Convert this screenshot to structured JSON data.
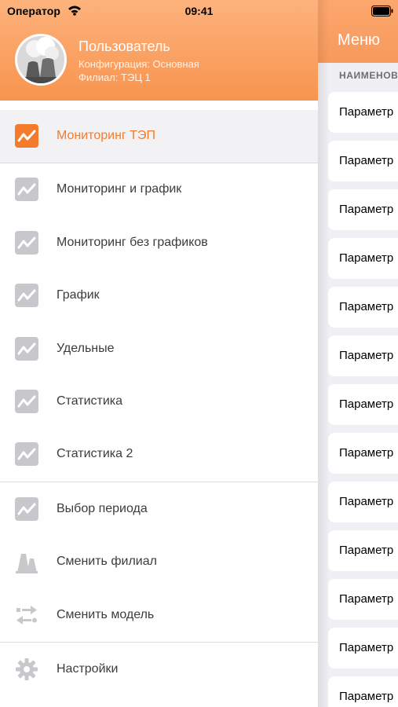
{
  "status_bar": {
    "carrier": "Оператор",
    "time": "09:41"
  },
  "background_screen": {
    "nav_title": "Меню",
    "section_header": "НАИМЕНОВ",
    "rows": [
      "Параметр",
      "Параметр",
      "Параметр",
      "Параметр",
      "Параметр",
      "Параметр",
      "Параметр",
      "Параметр",
      "Параметр",
      "Параметр",
      "Параметр",
      "Параметр",
      "Параметр"
    ]
  },
  "drawer": {
    "user": {
      "name": "Пользователь",
      "configuration": "Конфигурация: Основная",
      "branch": "Филиал: ТЭЦ 1"
    },
    "menu_items": [
      {
        "label": "Мониторинг ТЭП",
        "icon": "chart-icon",
        "selected": true
      },
      {
        "label": "Мониторинг и график",
        "icon": "chart-icon"
      },
      {
        "label": "Мониторинг без графиков",
        "icon": "chart-icon"
      },
      {
        "label": "График",
        "icon": "chart-icon"
      },
      {
        "label": "Удельные",
        "icon": "chart-icon"
      },
      {
        "label": "Статистика",
        "icon": "chart-icon"
      },
      {
        "label": "Статистика 2",
        "icon": "chart-icon"
      },
      {
        "label": "Выбор периода",
        "icon": "chart-icon"
      },
      {
        "label": "Сменить филиал",
        "icon": "plant-icon"
      },
      {
        "label": "Сменить модель",
        "icon": "switch-icon"
      },
      {
        "label": "Настройки",
        "icon": "gear-icon"
      }
    ]
  },
  "colors": {
    "accent": "#f47a2c",
    "header": "#f8944f",
    "icon_gray": "#c7c7cc"
  }
}
